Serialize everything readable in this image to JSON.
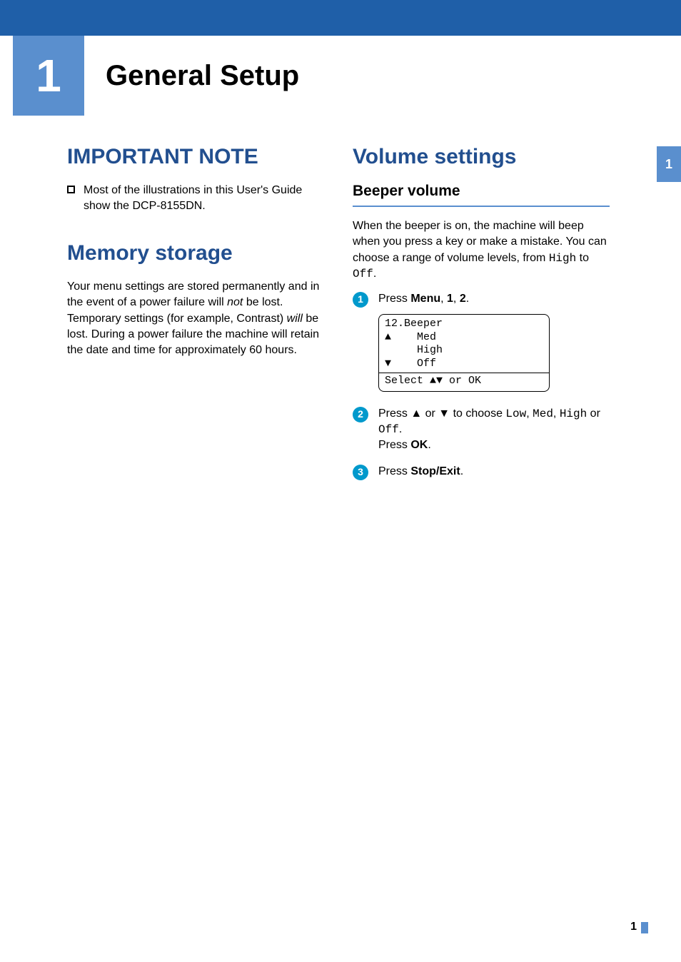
{
  "chapter": {
    "number": "1",
    "title": "General Setup"
  },
  "page_tab": "1",
  "page_number": "1",
  "left": {
    "important_note": {
      "heading": "IMPORTANT NOTE",
      "bullet": "Most of the illustrations in this User's Guide show the DCP-8155DN."
    },
    "memory_storage": {
      "heading": "Memory storage",
      "body_pre": "Your menu settings are stored permanently and in the event of a power failure will ",
      "body_not": "not",
      "body_mid": " be lost. Temporary settings (for example, Contrast) ",
      "body_will": "will",
      "body_post": " be lost. During a power failure the machine will retain the date and time for approximately 60 hours."
    }
  },
  "right": {
    "volume_settings": {
      "heading": "Volume settings"
    },
    "beeper": {
      "heading": "Beeper volume",
      "intro_pre": "When the beeper is on, the machine will beep when you press a key or make a mistake. You can choose a range of volume levels, from ",
      "intro_high": "High",
      "intro_mid": " to ",
      "intro_off": "Off",
      "intro_post": ".",
      "steps": {
        "s1": {
          "num": "1",
          "pre": "Press ",
          "menu": "Menu",
          "sep1": ", ",
          "k1": "1",
          "sep2": ", ",
          "k2": "2",
          "post": "."
        },
        "lcd": {
          "line1": "12.Beeper",
          "line2": "▲    Med",
          "line3": "     High",
          "line4": "▼    Off",
          "select": "Select ▲▼ or OK"
        },
        "s2": {
          "num": "2",
          "pre": "Press ▲ or ▼ to choose ",
          "low": "Low",
          "c1": ", ",
          "med": "Med",
          "c2": ", ",
          "high": "High",
          "or": " or ",
          "off": "Off",
          "dot": ".",
          "press": "Press ",
          "ok": "OK",
          "dot2": "."
        },
        "s3": {
          "num": "3",
          "press": "Press ",
          "stop": "Stop/Exit",
          "dot": "."
        }
      }
    }
  }
}
